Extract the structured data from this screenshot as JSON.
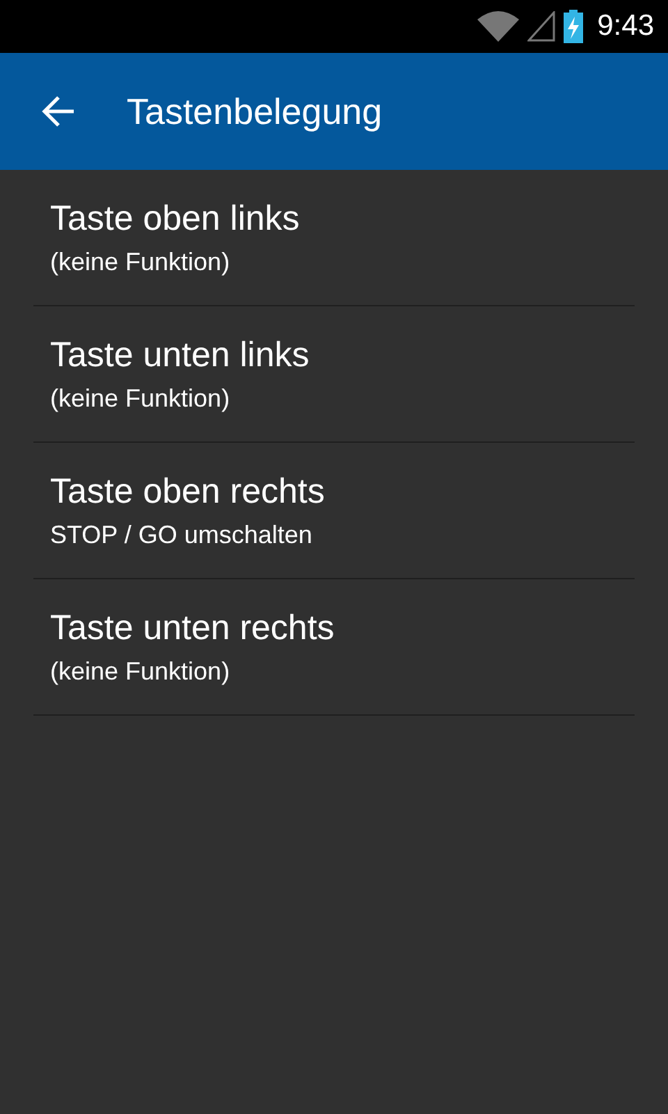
{
  "status_bar": {
    "time": "9:43"
  },
  "app_bar": {
    "title": "Tastenbelegung"
  },
  "items": [
    {
      "title": "Taste oben links",
      "summary": "(keine Funktion)"
    },
    {
      "title": "Taste unten links",
      "summary": "(keine Funktion)"
    },
    {
      "title": "Taste oben rechts",
      "summary": "STOP / GO umschalten"
    },
    {
      "title": "Taste unten rechts",
      "summary": "(keine Funktion)"
    }
  ]
}
